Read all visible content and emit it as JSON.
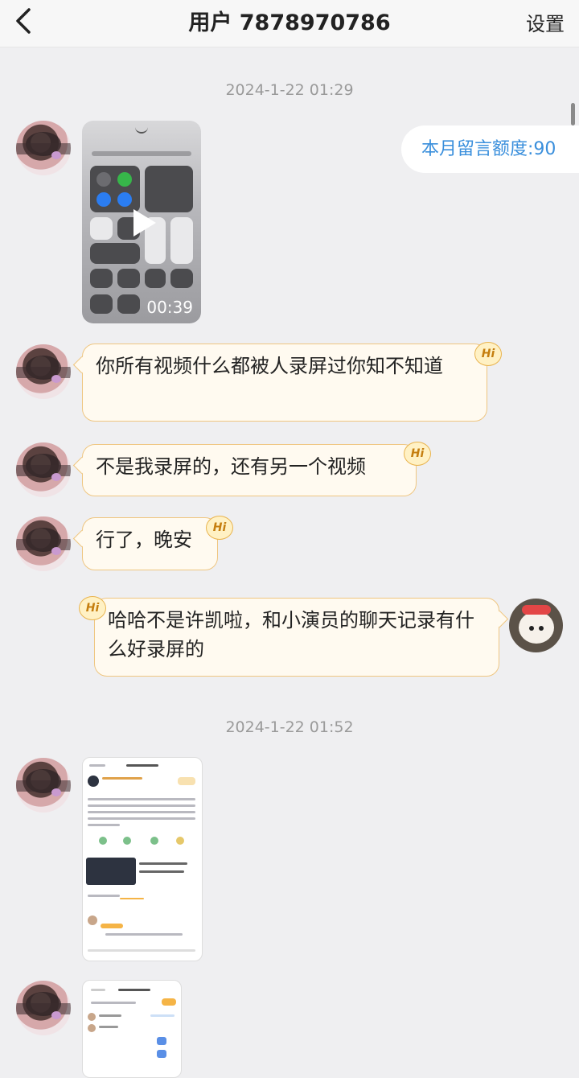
{
  "header": {
    "back_icon": "chevron-left-icon",
    "title": "用户 7878970786",
    "settings_label": "设置"
  },
  "quota": {
    "text": "本月留言额度:90"
  },
  "messages": {
    "timestamp_1": "2024-1-22 01:29",
    "video_duration": "00:39",
    "text_1": "你所有视频什么都被人录屏过你知不知道",
    "text_2": "不是我录屏的，还有另一个视频",
    "text_3": "行了，晚安",
    "text_4": "哈哈不是许凯啦，和小演员的聊天记录有什么好录屏的",
    "timestamp_2": "2024-1-22 01:52"
  },
  "badge": {
    "label": "Hi"
  },
  "colors": {
    "bubble_bg": "#fffaf0",
    "bubble_border": "#efc681",
    "quota_text": "#3a8fdc",
    "timestamp": "#9a9a9a"
  }
}
